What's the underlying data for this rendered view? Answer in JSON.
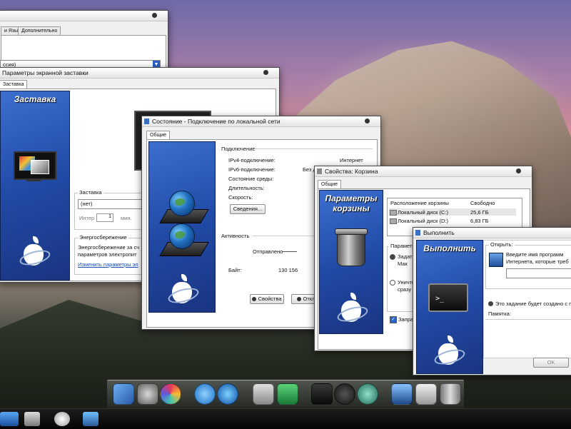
{
  "win_regional": {
    "tabs": [
      "и Язык",
      "Дополнительно"
    ],
    "select_value": "ссия)"
  },
  "win_screensaver": {
    "title": "Параметры экранной заставки",
    "tab": "Заставка",
    "sidebar_title": "Заставка",
    "group_screensaver": "Заставка",
    "select_value": "(нет)",
    "interval_label": "Интер",
    "interval_value": "1",
    "minutes_label": "мин.",
    "group_power": "Энергосбережение",
    "power_text_1": "Энергосбережение за сч",
    "power_text_2": "параметров электропит",
    "power_link": "Изменить параметры эл"
  },
  "win_network": {
    "title": "Состояние - Подключение по локальной сети",
    "tab": "Общие",
    "section_connection": "Подключение",
    "ipv4_label": "IPv4-подключение:",
    "ipv4_value": "Интернет",
    "ipv6_label": "IPv6-подключение:",
    "ipv6_value": "Без д",
    "media_label": "Состояние среды:",
    "duration_label": "Длительность:",
    "speed_label": "Скорость:",
    "details_button": "Сведения...",
    "section_activity": "Активность",
    "sent_label": "Отправлено",
    "bytes_label": "Байт:",
    "bytes_value": "130 156",
    "properties_button": "Свойства",
    "disable_button": "Откл"
  },
  "win_recycle": {
    "title": "Свойства: Корзина",
    "tab": "Общие",
    "sidebar_title_1": "Параметры",
    "sidebar_title_2": "корзины",
    "col_location": "Расположение корзины",
    "col_free": "Свободно",
    "disks": [
      {
        "name": "Локальный диск (C:)",
        "free": "25,6 ГБ"
      },
      {
        "name": "Локальный диск (D:)",
        "free": "6,83 ГБ"
      }
    ],
    "group_params": "Параметр",
    "radio1_a": "Задать",
    "radio1_b": "Мак",
    "radio2": "Уничто",
    "radio2_b": "сразу",
    "checkbox": "Запраш"
  },
  "win_run": {
    "title": "Выполнить",
    "sidebar_title": "Выполнить",
    "open_label": "Открыть:",
    "desc_1": "Введите имя программ",
    "desc_2": "Интернета, которые треб",
    "admin_text": "Это задание будет создано с п",
    "memo_label": "Памятка:",
    "ok_button": "OK"
  },
  "dock_icons": [
    "finder-icon",
    "system-preferences-icon",
    "game-center-icon",
    "internet-explorer-icon",
    "media-player-icon",
    "disk-icon",
    "network-icon",
    "calculator-icon",
    "dashboard-icon",
    "time-machine-icon",
    "windows-flip-icon",
    "share-icon",
    "trash-icon"
  ]
}
